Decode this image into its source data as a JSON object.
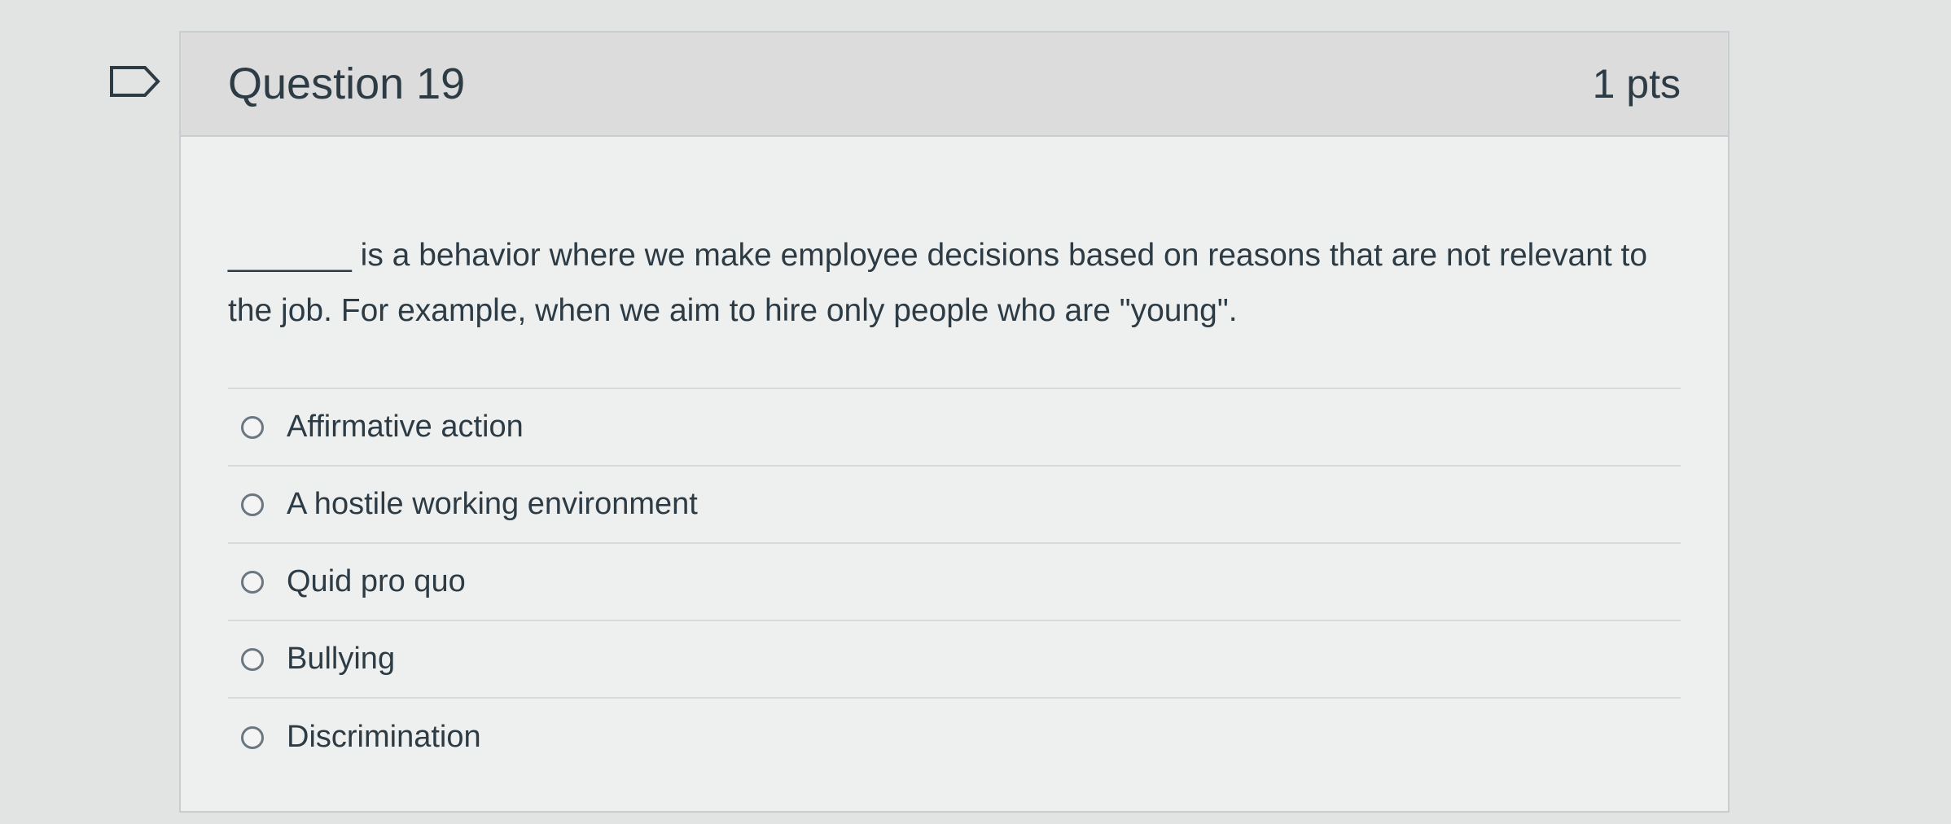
{
  "question": {
    "title": "Question 19",
    "points": "1 pts",
    "prompt": "_______ is a behavior where we make employee decisions based on reasons that are not relevant to the job.  For example, when we aim to hire only people who are \"young\"."
  },
  "answers": [
    {
      "label": "Affirmative action"
    },
    {
      "label": "A hostile working environment"
    },
    {
      "label": "Quid pro quo"
    },
    {
      "label": "Bullying"
    },
    {
      "label": "Discrimination"
    }
  ],
  "icons": {
    "flag": "bookmark-flag-icon",
    "radio": "radio-unselected-icon"
  },
  "colors": {
    "background": "#e2e3e3",
    "header": "#dcdcdc",
    "card": "#eeefef",
    "text": "#2d3b45",
    "border": "#c7cdd1"
  }
}
